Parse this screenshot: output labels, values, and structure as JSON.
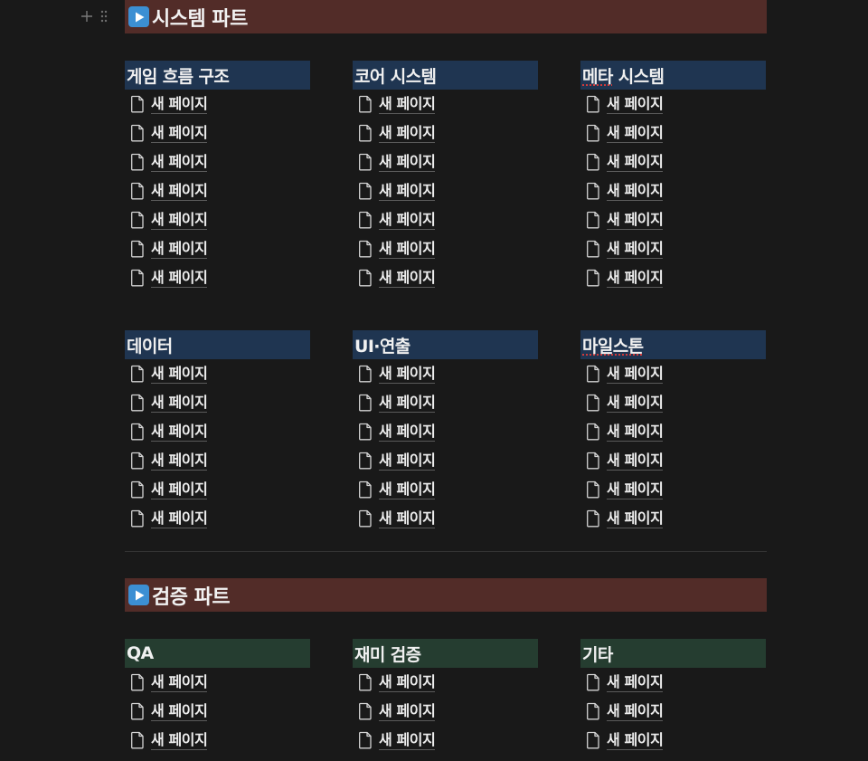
{
  "colors": {
    "background": "#191919",
    "section_header_bg": "#522c28",
    "column_header_blue": "#1f3551",
    "column_header_green": "#253d30",
    "play_icon_bg": "#3c8fd3"
  },
  "block_handle": {
    "plus_icon": "plus-icon",
    "drag_icon": "drag-handle-icon"
  },
  "system_part": {
    "title": "시스템 파트",
    "icon": "play-button-icon",
    "columns": [
      {
        "header": "게임 흐름 구조",
        "items": [
          "새 페이지",
          "새 페이지",
          "새 페이지",
          "새 페이지",
          "새 페이지",
          "새 페이지",
          "새 페이지"
        ]
      },
      {
        "header": "코어 시스템",
        "items": [
          "새 페이지",
          "새 페이지",
          "새 페이지",
          "새 페이지",
          "새 페이지",
          "새 페이지",
          "새 페이지"
        ]
      },
      {
        "header": "메타 시스템",
        "items": [
          "새 페이지",
          "새 페이지",
          "새 페이지",
          "새 페이지",
          "새 페이지",
          "새 페이지",
          "새 페이지"
        ]
      },
      {
        "header": "데이터",
        "items": [
          "새 페이지",
          "새 페이지",
          "새 페이지",
          "새 페이지",
          "새 페이지",
          "새 페이지"
        ]
      },
      {
        "header": "UI·연출",
        "items": [
          "새 페이지",
          "새 페이지",
          "새 페이지",
          "새 페이지",
          "새 페이지",
          "새 페이지"
        ]
      },
      {
        "header": "마일스톤",
        "items": [
          "새 페이지",
          "새 페이지",
          "새 페이지",
          "새 페이지",
          "새 페이지",
          "새 페이지"
        ]
      }
    ]
  },
  "verification_part": {
    "title": "검증 파트",
    "icon": "play-button-icon",
    "columns": [
      {
        "header": "QA",
        "items": [
          "새 페이지",
          "새 페이지",
          "새 페이지"
        ]
      },
      {
        "header": "재미 검증",
        "items": [
          "새 페이지",
          "새 페이지",
          "새 페이지"
        ]
      },
      {
        "header": "기타",
        "items": [
          "새 페이지",
          "새 페이지",
          "새 페이지"
        ]
      }
    ]
  },
  "page_icon": "page-document-icon"
}
